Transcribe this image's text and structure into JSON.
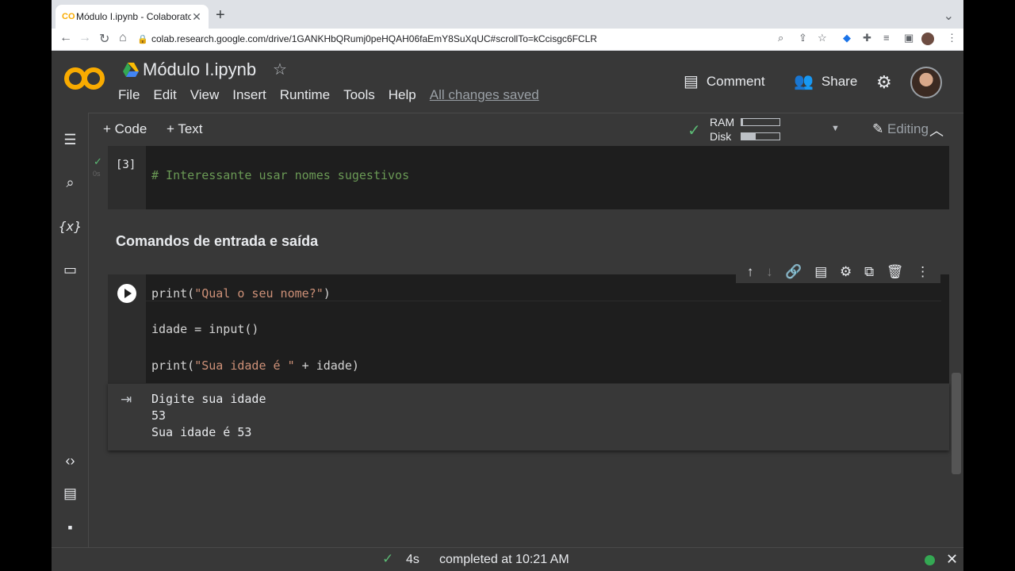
{
  "browser": {
    "tab_title": "Módulo I.ipynb - Colaboratory",
    "url": "colab.research.google.com/drive/1GANKHbQRumj0peHQAH06faEmY8SuXqUC#scrollTo=kCcisgc6FCLR"
  },
  "header": {
    "notebook_title": "Módulo I.ipynb",
    "menu": [
      "File",
      "Edit",
      "View",
      "Insert",
      "Runtime",
      "Tools",
      "Help"
    ],
    "saved_status": "All changes saved",
    "comment_label": "Comment",
    "share_label": "Share"
  },
  "toolbar": {
    "add_code": "+ Code",
    "add_text": "+ Text",
    "ram_label": "RAM",
    "disk_label": "Disk",
    "ram_usage": 0.05,
    "disk_usage": 0.38,
    "editing_label": "Editing"
  },
  "cells": {
    "cell1": {
      "exec_count": "[3]",
      "duration": "0s",
      "code": "# Interessante usar nomes sugestivos"
    },
    "section_heading": "Comandos de entrada e saída",
    "cell2": {
      "line1_fn": "print(",
      "line1_str": "\"Qual o seu nome?\"",
      "line1_end": ")",
      "line2": "idade = input()",
      "line3_fn": "print(",
      "line3_str": "\"Sua idade é \"",
      "line3_end": " + idade)",
      "output": [
        "Digite sua idade",
        "53",
        "Sua idade é 53"
      ]
    }
  },
  "statusbar": {
    "duration": "4s",
    "message": "completed at 10:21 AM"
  },
  "colors": {
    "accent_green": "#5bb974",
    "logo_orange": "#f9ab00",
    "string_color": "#ce9178",
    "comment_color": "#6a9955"
  }
}
